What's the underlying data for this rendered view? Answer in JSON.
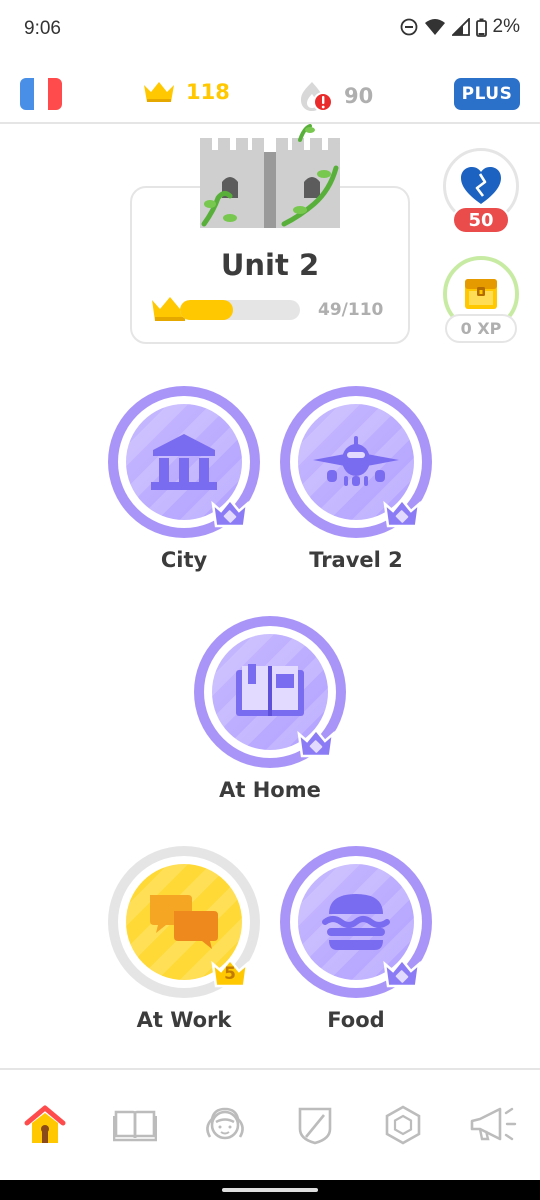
{
  "status_bar": {
    "time": "9:06",
    "battery": "2%"
  },
  "top_bar": {
    "flag_icon": "french-flag-icon",
    "crowns": "118",
    "streak": "90",
    "plus_label": "PLUS"
  },
  "unit": {
    "title": "Unit 2",
    "progress_text": "49/110",
    "progress": 0.445
  },
  "hearts": {
    "count": "50"
  },
  "chest": {
    "xp": "0 XP"
  },
  "skills": [
    {
      "label": "City",
      "icon": "bank-building-icon"
    },
    {
      "label": "Travel 2",
      "icon": "airplane-icon"
    },
    {
      "label": "At Home",
      "icon": "book-icon"
    },
    {
      "label": "At Work",
      "icon": "chat-bubbles-icon",
      "crown_level": "5"
    },
    {
      "label": "Food",
      "icon": "burger-icon"
    }
  ],
  "bottom_nav": [
    "home-icon",
    "stories-icon",
    "profile-icon",
    "leagues-icon",
    "shop-icon",
    "news-icon"
  ],
  "colors": {
    "crown": "#ffc800",
    "plus": "#2b70c9",
    "skill_purple": "#b8a8ff",
    "skill_ring": "#a995f8",
    "hearts": "#ea4b4b",
    "blue_heart": "#1c62c0",
    "gold": "#ffd936"
  }
}
